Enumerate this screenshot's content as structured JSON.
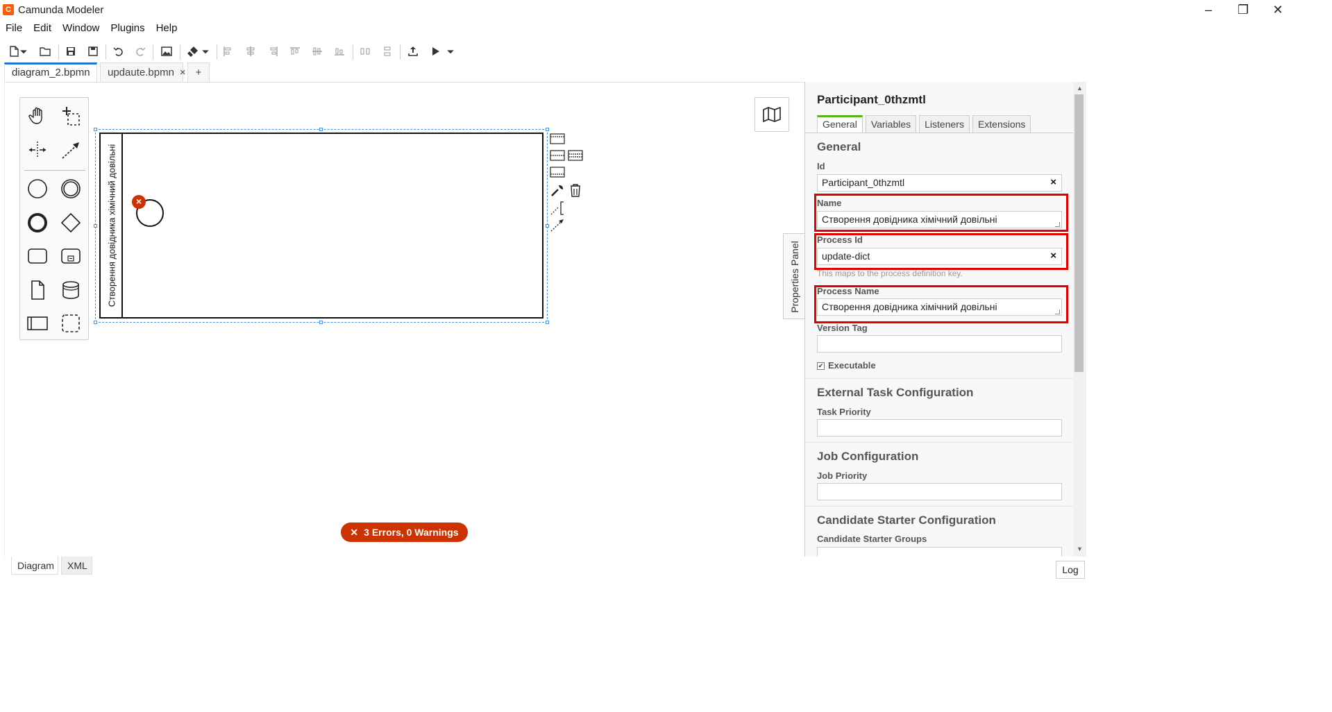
{
  "window": {
    "title": "Camunda Modeler",
    "logo_glyph": "C",
    "minimize": "–",
    "restore": "❐",
    "close": "✕"
  },
  "menu": [
    "File",
    "Edit",
    "Window",
    "Plugins",
    "Help"
  ],
  "toolbar": {
    "icons": [
      "new-file-icon",
      "open-folder-icon",
      "save-icon",
      "save-as-icon",
      "undo-icon",
      "redo-icon",
      "export-image-icon",
      "color-brush-icon",
      "align-left-icon",
      "align-center-icon",
      "align-right-icon",
      "align-top-icon",
      "align-middle-icon",
      "align-bottom-icon",
      "distribute-horizontal-icon",
      "distribute-vertical-icon",
      "deploy-icon",
      "start-instance-icon"
    ]
  },
  "tabs": [
    {
      "label": "diagram_2.bpmn",
      "active": true,
      "close": "○"
    },
    {
      "label": "updaute.bpmn",
      "active": false,
      "close": "×"
    }
  ],
  "add_tab": "+",
  "diagram": {
    "participant_name": "Створення довідника хімічний довільні",
    "error_badge": "×"
  },
  "status": {
    "error_icon": "✕",
    "errors_text": "3 Errors, 0 Warnings"
  },
  "bottom_tabs": [
    "Diagram",
    "XML"
  ],
  "log_label": "Log",
  "properties_toggle": "Properties Panel",
  "properties": {
    "title": "Participant_0thzmtl",
    "tabs": [
      "General",
      "Variables",
      "Listeners",
      "Extensions"
    ],
    "general_header": "General",
    "id_label": "Id",
    "id_value": "Participant_0thzmtl",
    "name_label": "Name",
    "name_value": "Створення довідника хімічний довільні",
    "process_id_label": "Process Id",
    "process_id_value": "update-dict",
    "process_id_hint": "This maps to the process definition key.",
    "process_name_label": "Process Name",
    "process_name_value": "Створення довідника хімічний довільні",
    "version_tag_label": "Version Tag",
    "version_tag_value": "",
    "executable_label": "Executable",
    "executable_checked": true,
    "external_task_header": "External Task Configuration",
    "task_priority_label": "Task Priority",
    "job_config_header": "Job Configuration",
    "job_priority_label": "Job Priority",
    "candidate_header": "Candidate Starter Configuration",
    "candidate_groups_label": "Candidate Starter Groups",
    "clear_glyph": "×"
  },
  "colors": {
    "accent_tab": "#1f73d2",
    "props_tab_accent": "#52b415",
    "error": "#cc3300",
    "highlight": "#e00000",
    "brand": "#fc5d0d"
  }
}
